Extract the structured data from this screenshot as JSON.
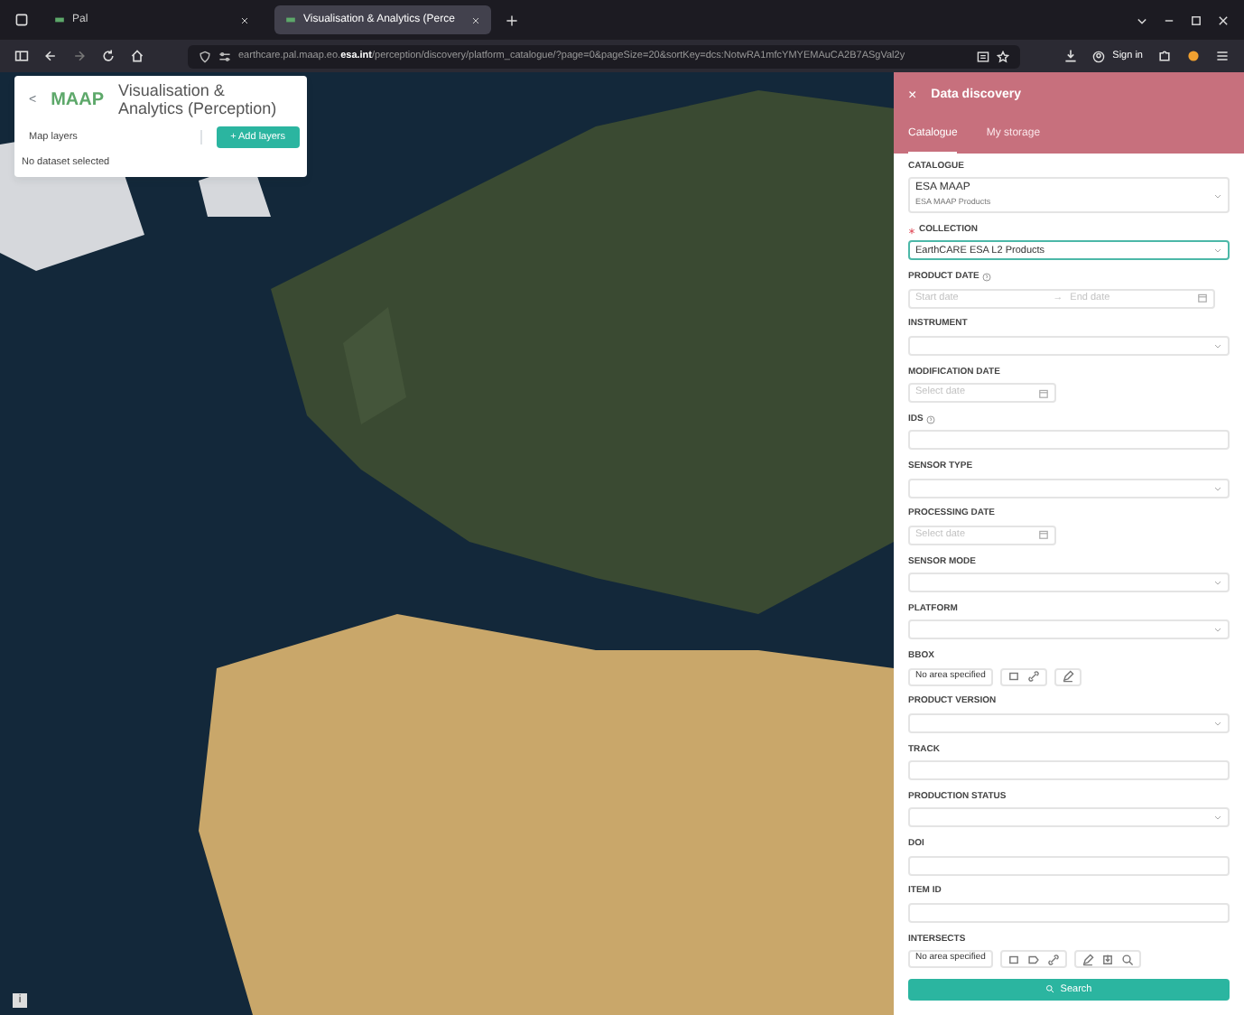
{
  "browser": {
    "tabs": [
      {
        "label": "Pal",
        "selected": false
      },
      {
        "label": "Visualisation & Analytics (Perce",
        "selected": true
      }
    ],
    "url_host": "earthcare.pal.maap.eo.",
    "url_domain": "esa.int",
    "url_path": "/perception/discovery/platform_catalogue/?page=0&pageSize=20&sortKey=dcs:NotwRA1mfcYMYEMAuCA2B7ASgVal2y",
    "sign_in": "Sign in"
  },
  "layers_panel": {
    "back": "<",
    "logo": "MAAP",
    "title": "Visualisation & Analytics (Perception)",
    "layers_label": "Map layers",
    "add_button": "+ Add layers",
    "status": "No dataset selected"
  },
  "discovery": {
    "close": "×",
    "title": "Data discovery",
    "tabs": [
      {
        "label": "Catalogue",
        "selected": true
      },
      {
        "label": "My storage",
        "selected": false
      }
    ],
    "fields": [
      {
        "kind": "select",
        "label": "CATALOGUE",
        "value": "ESA MAAP",
        "subvalue": "ESA MAAP Products"
      },
      {
        "kind": "select",
        "label": "COLLECTION",
        "required": true,
        "value": "EarthCARE ESA L2 Products",
        "focused": true
      },
      {
        "kind": "daterange",
        "label": "PRODUCT DATE",
        "help": true,
        "placeholder": "Start date",
        "placeholder_end": "End date",
        "separator": "→"
      },
      {
        "kind": "select",
        "label": "INSTRUMENT"
      },
      {
        "kind": "date",
        "label": "MODIFICATION DATE",
        "placeholder": "Select date"
      },
      {
        "kind": "text",
        "label": "IDS",
        "help": true
      },
      {
        "kind": "select",
        "label": "SENSOR TYPE"
      },
      {
        "kind": "date",
        "label": "PROCESSING DATE",
        "placeholder": "Select date"
      },
      {
        "kind": "select",
        "label": "SENSOR MODE"
      },
      {
        "kind": "select",
        "label": "PLATFORM"
      },
      {
        "kind": "bbox",
        "label": "BBOX",
        "status": "No area specified"
      },
      {
        "kind": "select",
        "label": "PRODUCT VERSION"
      },
      {
        "kind": "text",
        "label": "TRACK"
      },
      {
        "kind": "select",
        "label": "PRODUCTION STATUS"
      },
      {
        "kind": "text",
        "label": "DOI"
      },
      {
        "kind": "text",
        "label": "ITEM ID"
      },
      {
        "kind": "intersects",
        "label": "INTERSECTS",
        "status": "No area specified"
      }
    ],
    "search_button": "Search"
  },
  "info_button": "i"
}
